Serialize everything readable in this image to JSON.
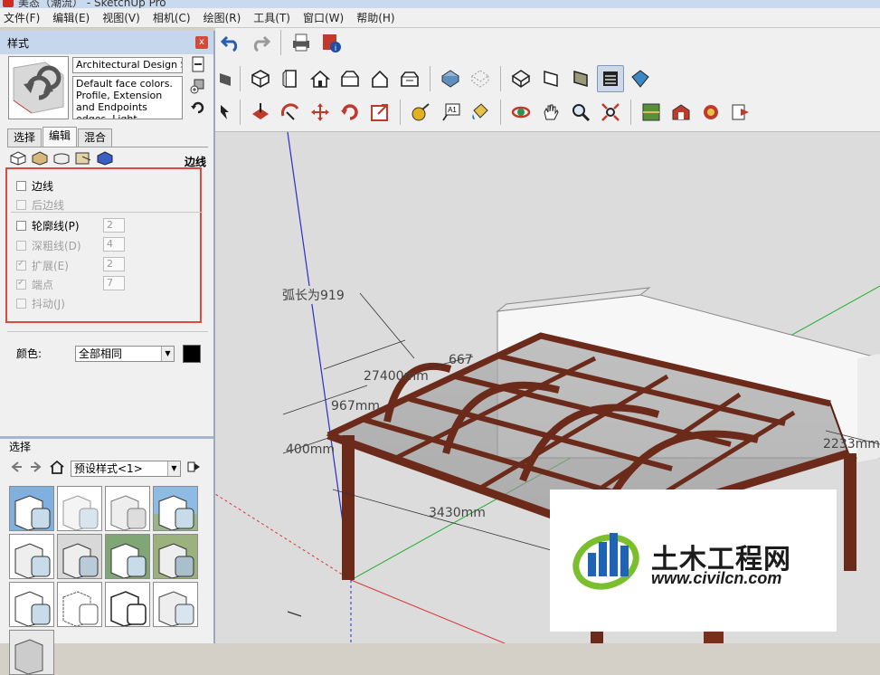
{
  "window": {
    "title": "美态（潮流） - SketchUp Pro"
  },
  "menu": [
    "文件(F)",
    "编辑(E)",
    "视图(V)",
    "相机(C)",
    "绘图(R)",
    "工具(T)",
    "窗口(W)",
    "帮助(H)"
  ],
  "panel": {
    "title": "样式",
    "close_label": "x",
    "style_name": "Architectural Design Style",
    "style_desc": "Default face colors. Profile, Extension and Endpoints edges. Light",
    "tabs": [
      "选择",
      "编辑",
      "混合"
    ],
    "active_tab": "编辑",
    "section_label": "边线",
    "options": {
      "edges": "边线",
      "back_edges": "后边线",
      "profiles": "轮廓线(P)",
      "profiles_val": "2",
      "depth_cue": "深粗线(D)",
      "depth_cue_val": "4",
      "extension": "扩展(E)",
      "extension_val": "2",
      "endpoints": "端点",
      "endpoints_val": "7",
      "jitter": "抖动(J)"
    },
    "color_label": "颜色:",
    "color_value": "全部相同",
    "color_swatch": "#000000",
    "select_section": "选择",
    "collection": "预设样式<1>"
  },
  "viewport": {
    "annotations": {
      "arc": "弧长为919",
      "dim1": "27400mm",
      "dim2": "667",
      "dim3": "967mm",
      "dim4": "400mm",
      "dim5": "3430mm",
      "dim6": "2233mm"
    }
  },
  "watermark": {
    "brand": "土木工程网",
    "url": "www.civilcn.com"
  }
}
